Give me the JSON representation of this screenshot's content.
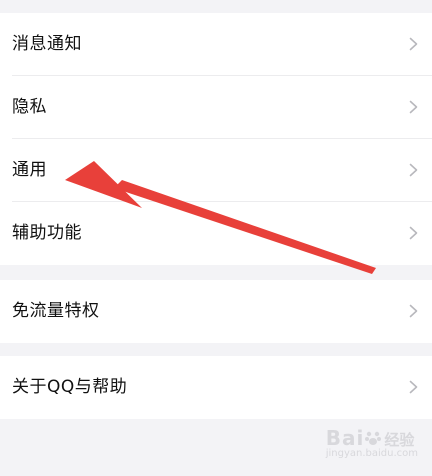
{
  "groups": [
    {
      "items": [
        {
          "label": "消息通知"
        },
        {
          "label": "隐私"
        },
        {
          "label": "通用"
        },
        {
          "label": "辅助功能"
        }
      ]
    },
    {
      "items": [
        {
          "label": "免流量特权"
        }
      ]
    },
    {
      "items": [
        {
          "label": "关于QQ与帮助"
        }
      ]
    }
  ],
  "annotation": {
    "type": "red-arrow",
    "color": "#e8403a",
    "points_to": "通用"
  },
  "watermark": {
    "brand": "Bai",
    "brand_suffix": "经验",
    "url": "jingyan.baidu.com"
  }
}
